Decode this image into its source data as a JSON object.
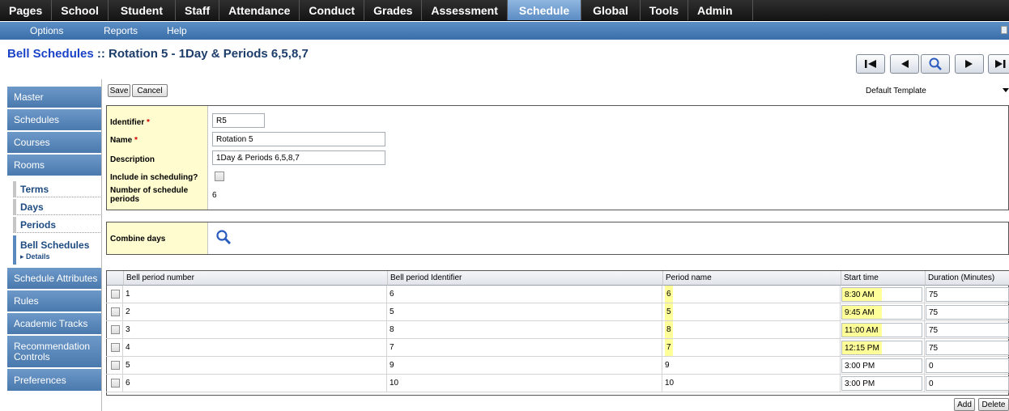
{
  "topnav": {
    "tabs": [
      {
        "label": "Pages"
      },
      {
        "label": "School"
      },
      {
        "label": "Student"
      },
      {
        "label": "Staff"
      },
      {
        "label": "Attendance"
      },
      {
        "label": "Conduct"
      },
      {
        "label": "Grades"
      },
      {
        "label": "Assessment"
      },
      {
        "label": "Schedule"
      },
      {
        "label": "Global"
      },
      {
        "label": "Tools"
      },
      {
        "label": "Admin"
      }
    ],
    "active_tab": "Schedule"
  },
  "subnav": {
    "options": "Options",
    "reports": "Reports",
    "help": "Help"
  },
  "title": {
    "link": "Bell Schedules",
    "separator": " :: ",
    "record": "Rotation 5 - 1Day & Periods 6,5,8,7"
  },
  "sidenav": {
    "items": [
      "Master",
      "Schedules",
      "Courses",
      "Rooms"
    ],
    "sub_items": [
      "Terms",
      "Days",
      "Periods",
      "Bell Schedules"
    ],
    "details": "▸ Details",
    "items_after": [
      "Schedule Attributes",
      "Rules",
      "Academic Tracks",
      "Recommendation Controls",
      "Preferences"
    ]
  },
  "toolbar": {
    "save": "Save",
    "cancel": "Cancel",
    "template": "Default Template"
  },
  "form": {
    "identifier_label": "Identifier",
    "identifier_value": "R5",
    "name_label": "Name",
    "name_value": "Rotation 5",
    "description_label": "Description",
    "description_value": "1Day & Periods 6,5,8,7",
    "include_label": "Include in scheduling?",
    "num_periods_label": "Number of schedule periods",
    "num_periods_value": "6",
    "combine_label": "Combine days",
    "required_marker": "*"
  },
  "grid": {
    "headers": {
      "number": "Bell period number",
      "identifier": "Bell period Identifier",
      "period_name": "Period name",
      "start": "Start time",
      "duration": "Duration (Minutes)"
    },
    "rows": [
      {
        "number": "1",
        "identifier": "6",
        "period_name": "6",
        "start": "8:30 AM",
        "duration": "75",
        "highlight": true
      },
      {
        "number": "2",
        "identifier": "5",
        "period_name": "5",
        "start": "9:45 AM",
        "duration": "75",
        "highlight": true
      },
      {
        "number": "3",
        "identifier": "8",
        "period_name": "8",
        "start": "11:00 AM",
        "duration": "75",
        "highlight": true
      },
      {
        "number": "4",
        "identifier": "7",
        "period_name": "7",
        "start": "12:15 PM",
        "duration": "75",
        "highlight": true
      },
      {
        "number": "5",
        "identifier": "9",
        "period_name": "9",
        "start": "3:00 PM",
        "duration": "0",
        "highlight": false
      },
      {
        "number": "6",
        "identifier": "10",
        "period_name": "10",
        "start": "3:00 PM",
        "duration": "0",
        "highlight": false
      }
    ],
    "add": "Add",
    "delete": "Delete"
  },
  "colors": {
    "accent": "#5b8cc4",
    "highlight": "#ffff99",
    "label_bg": "#fffccf"
  }
}
